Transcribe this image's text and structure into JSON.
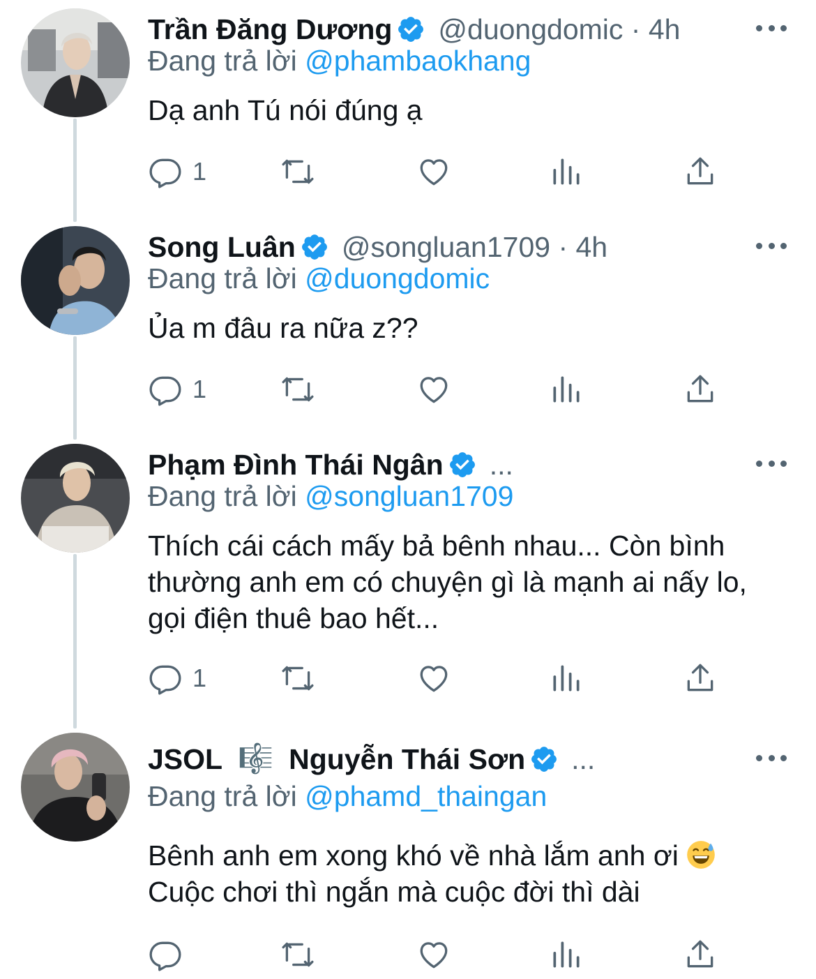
{
  "tweets": [
    {
      "name": "Trần Đăng Dương",
      "handle_line": "@duongdomic · 4h",
      "reply_label": "Đang trả lời",
      "reply_to": "@phambaokhang",
      "text": [
        "Dạ anh Tú nói đúng ạ"
      ],
      "reply_count": "1",
      "verified": true
    },
    {
      "name": "Song Luân",
      "handle_line": "@songluan1709 · 4h",
      "reply_label": "Đang trả lời",
      "reply_to": "@duongdomic",
      "text": [
        "Ủa m đâu ra nữa z??"
      ],
      "reply_count": "1",
      "verified": true
    },
    {
      "name": "Phạm Đình Thái Ngân",
      "truncation": "...",
      "reply_label": "Đang trả lời",
      "reply_to": "@songluan1709",
      "text": [
        "Thích cái cách mấy bả bênh nhau... Còn bình",
        "thường anh em có chuyện gì là mạnh ai nấy lo,",
        "gọi điện thuê bao hết..."
      ],
      "reply_count": "1",
      "verified": true
    },
    {
      "name_part1": "JSOL",
      "name_symbol": "🎼",
      "name_part2": "Nguyễn Thái Sơn",
      "truncation": "...",
      "reply_label": "Đang trả lời",
      "reply_to": "@phamd_thaingan",
      "text_line1": "Bênh anh em xong khó về nhà lắm anh ơi",
      "text_line2": "Cuộc chơi thì ngắn mà cuộc đời thì dài",
      "reply_count": "",
      "verified": true,
      "emoji": "grinning-face-with-sweat"
    }
  ],
  "icons": {
    "reply": "reply-icon",
    "retweet": "retweet-icon",
    "like": "like-icon",
    "analytics": "analytics-icon",
    "share": "share-icon",
    "more": "more-icon",
    "verified": "verified-badge-icon"
  },
  "colors": {
    "link": "#1d9bf0",
    "secondary": "#536471",
    "verified": "#1d9bf0",
    "thread_line": "#cfd9de"
  }
}
